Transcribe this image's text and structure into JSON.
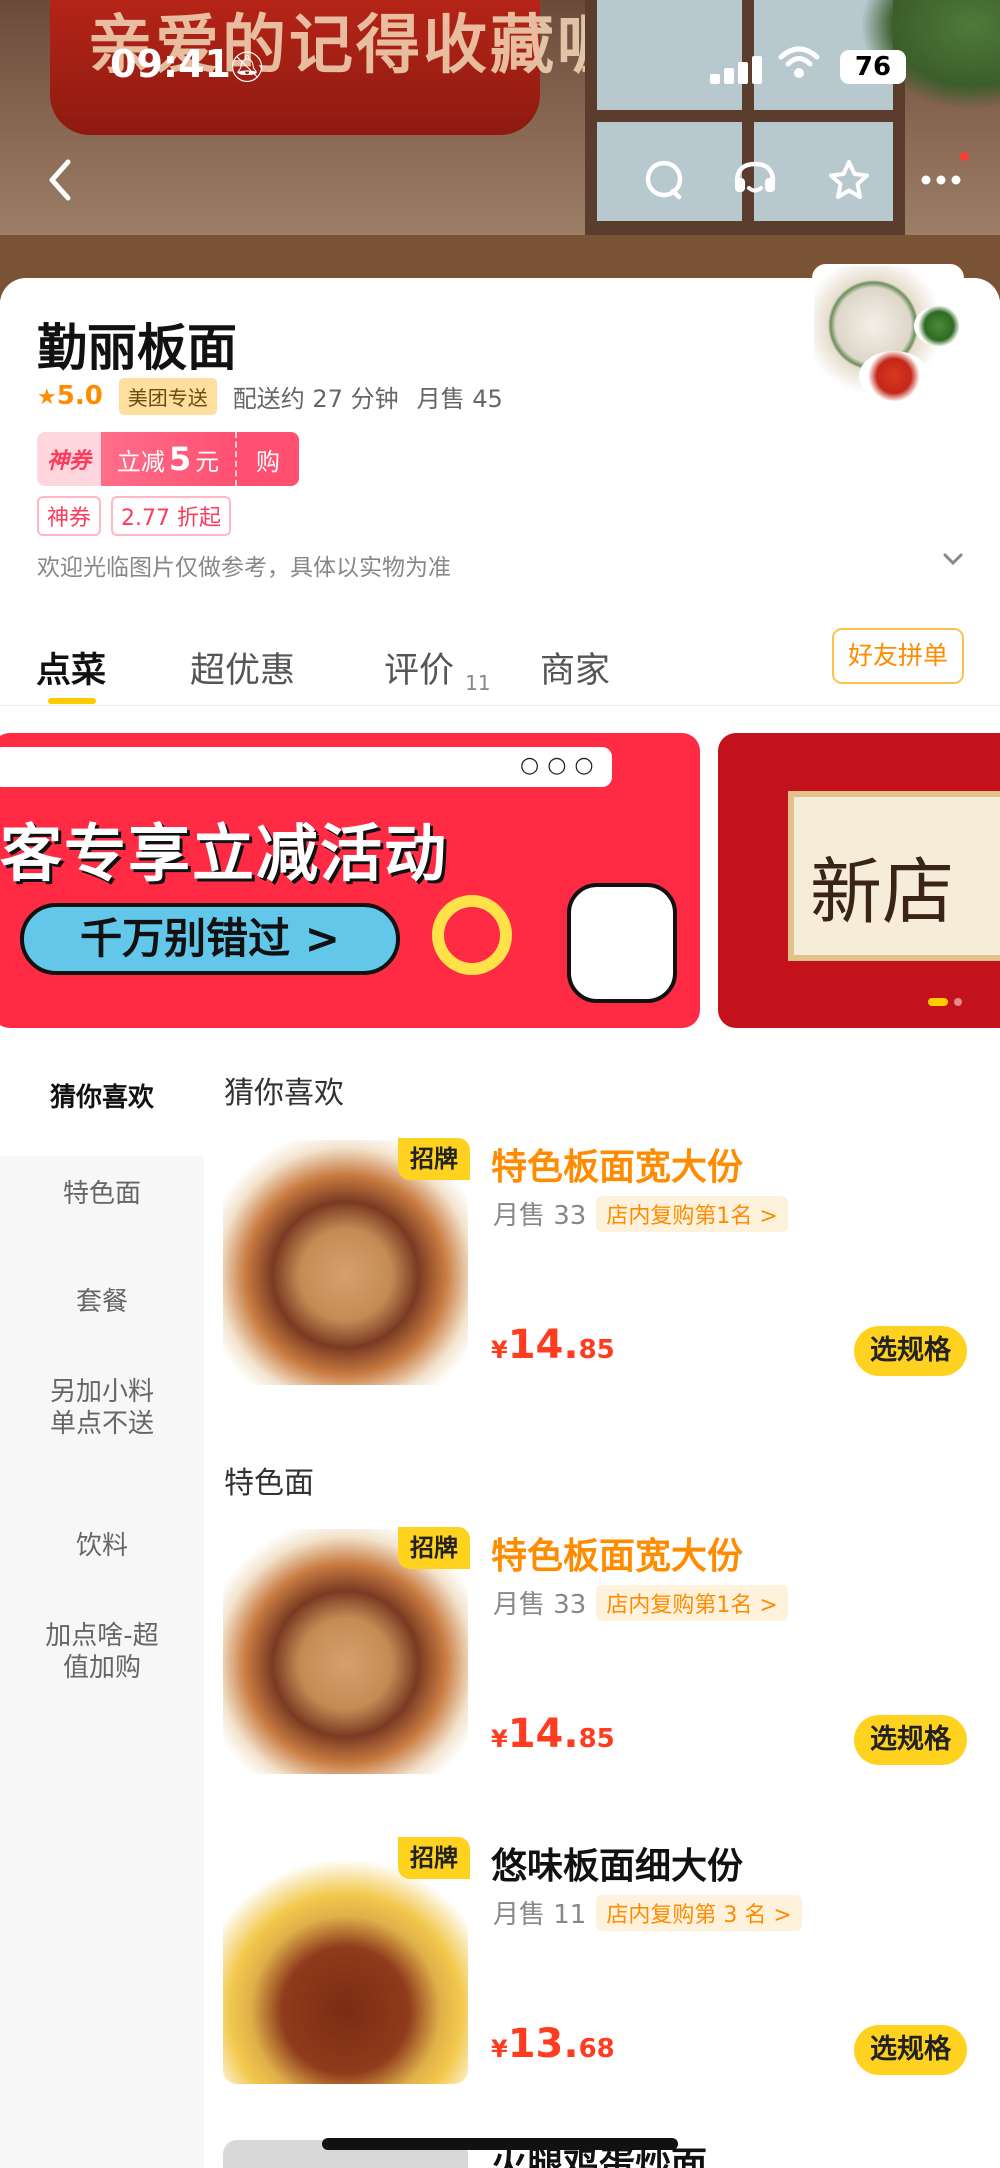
{
  "status_bar": {
    "time": "09:41",
    "battery": "76"
  },
  "header": {
    "banner_text": "亲爱的记得收藏喔"
  },
  "store": {
    "name": "勤丽板面",
    "rating": "5.0",
    "delivery_tag": "美团专送",
    "delivery_time": "配送约 27 分钟",
    "monthly_sales": "月售 45",
    "coupon": {
      "label": "神券",
      "text": "立减",
      "amount": "5",
      "unit": "元",
      "action": "购"
    },
    "tags": [
      "神券",
      "2.77 折起"
    ],
    "welcome": "欢迎光临图片仅做参考，具体以实物为准"
  },
  "tabs": [
    {
      "label": "点菜"
    },
    {
      "label": "超优惠"
    },
    {
      "label": "评价",
      "count": "11"
    },
    {
      "label": "商家"
    }
  ],
  "friend_order_button": "好友拼单",
  "promos": [
    {
      "title": "客专享立减活动",
      "button": "千万别错过 >"
    },
    {
      "title": "新店"
    }
  ],
  "sidebar": {
    "items": [
      "猜你喜欢",
      "特色面",
      "套餐",
      "另加小料\n单点不送",
      "饮料",
      "加点啥-超\n值加购"
    ]
  },
  "sections": [
    {
      "title": "猜你喜欢",
      "dishes": [
        {
          "badge": "招牌",
          "name": "特色板面宽大份",
          "sold": "月售 33",
          "rank": "店内复购第1名 >",
          "currency": "¥",
          "price_int": "14.",
          "price_dec": "85",
          "button": "选规格"
        }
      ]
    },
    {
      "title": "特色面",
      "dishes": [
        {
          "badge": "招牌",
          "name": "特色板面宽大份",
          "sold": "月售 33",
          "rank": "店内复购第1名 >",
          "currency": "¥",
          "price_int": "14.",
          "price_dec": "85",
          "button": "选规格"
        },
        {
          "badge": "招牌",
          "name": "悠味板面细大份",
          "sold": "月售 11",
          "rank": "店内复购第 3 名 >",
          "currency": "¥",
          "price_int": "13.",
          "price_dec": "68",
          "button": "选规格"
        }
      ]
    }
  ],
  "next_dish_partial": "火腿鸡蛋炒面"
}
